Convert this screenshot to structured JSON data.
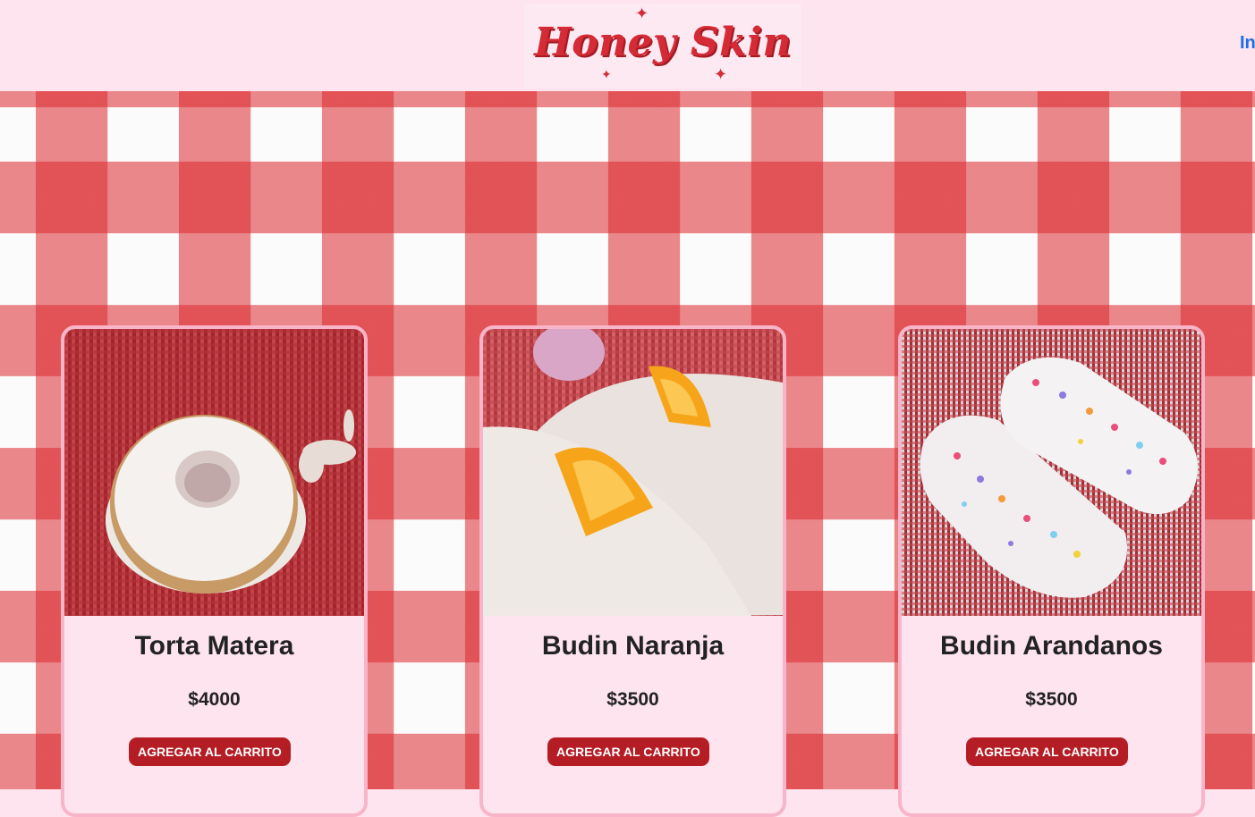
{
  "header": {
    "logo_text": "Honey Skin",
    "nav_link": "In"
  },
  "products": [
    {
      "name": "Torta Matera",
      "price": "$4000",
      "button": "AGREGAR AL CARRITO"
    },
    {
      "name": "Budin Naranja",
      "price": "$3500",
      "button": "AGREGAR AL CARRITO"
    },
    {
      "name": "Budin Arandanos",
      "price": "$3500",
      "button": "AGREGAR AL CARRITO"
    }
  ],
  "colors": {
    "brand_red": "#d42b36",
    "button_red": "#b41d24",
    "card_bg": "#fde4ef",
    "card_border": "#f8b5c9",
    "link_blue": "#1f6fe0"
  }
}
